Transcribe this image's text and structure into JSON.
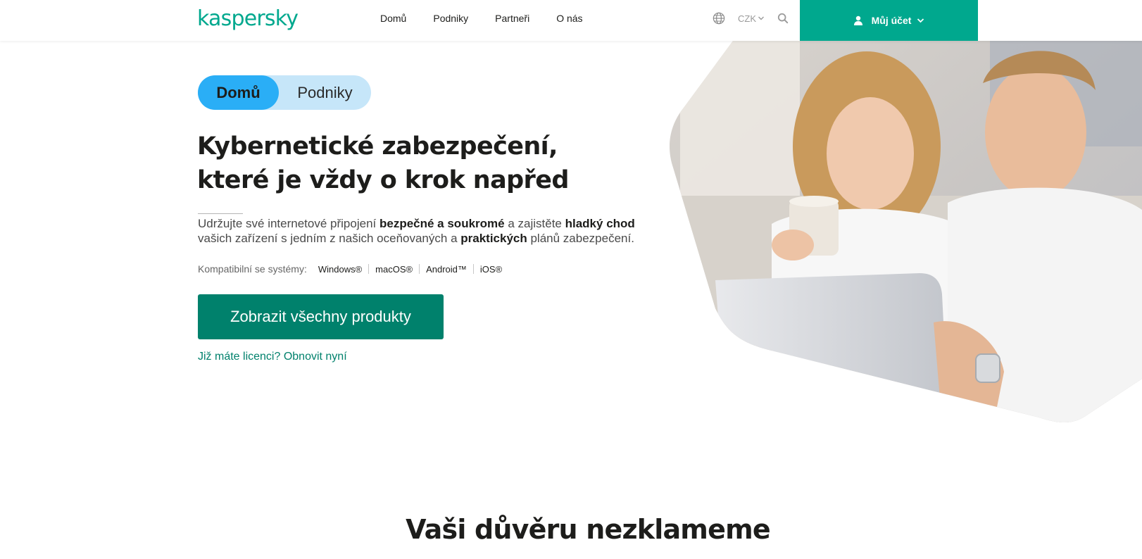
{
  "header": {
    "logo_text": "kaspersky",
    "nav": [
      {
        "label": "Domů"
      },
      {
        "label": "Podniky"
      },
      {
        "label": "Partneři"
      },
      {
        "label": "O nás"
      }
    ],
    "currency": "CZK",
    "account_label": "Můj účet",
    "icons": [
      "globe-icon",
      "chevron-down-icon",
      "search-icon",
      "user-icon"
    ]
  },
  "hero": {
    "toggle": {
      "active": "Domů",
      "inactive": "Podniky"
    },
    "title_line1": "Kybernetické zabezpečení,",
    "title_line2": "které je vždy o krok napřed",
    "text": {
      "part1": "Udržujte své internetové připojení ",
      "bold1": "bezpečné a soukromé",
      "part2": " a zajistěte ",
      "bold2": "hladký chod",
      "part3": " vašich zařízení s jedním z našich oceňovaných a ",
      "bold3": "praktických",
      "part4": " plánů zabezpečení."
    },
    "compat_label": "Kompatibilní se systémy:",
    "systems": [
      "Windows®",
      "macOS®",
      "Android™",
      "iOS®"
    ],
    "cta_label": "Zobrazit všechny produkty",
    "renew_label": "Již máte licenci? Obnovit nyní"
  },
  "trust_title": "Vaši důvěru nezklameme",
  "colors": {
    "brand_green": "#00a88e",
    "cta_green": "#00816c",
    "toggle_active": "#2aaef6",
    "toggle_bg": "#c6e6f9"
  }
}
